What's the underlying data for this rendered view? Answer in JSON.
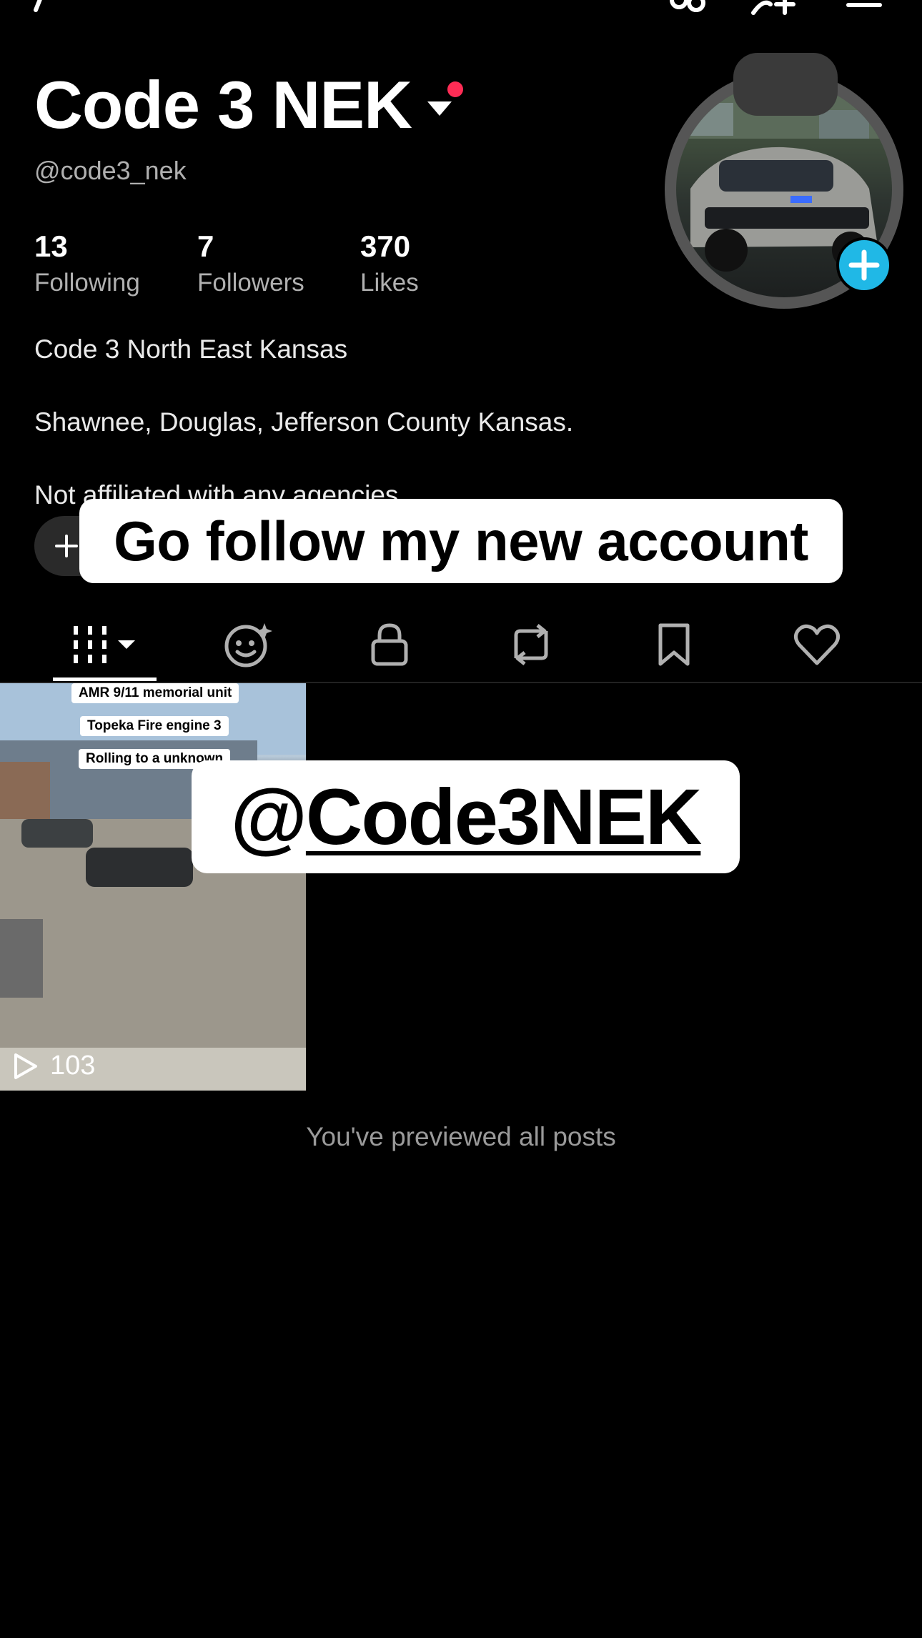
{
  "profile": {
    "display_name": "Code 3 NEK",
    "username": "@code3_nek",
    "stats": [
      {
        "value": "13",
        "label": "Following"
      },
      {
        "value": "7",
        "label": "Followers"
      },
      {
        "value": "370",
        "label": "Likes"
      }
    ],
    "bio": [
      "Code 3 North East Kansas",
      "Shawnee, Douglas, Jefferson County Kansas.",
      "Not affiliated with any agencies."
    ]
  },
  "overlay": {
    "sticker_top": "Go follow my new account",
    "sticker_handle_at": "@",
    "sticker_handle_name": "Code3NEK"
  },
  "tabs": [
    {
      "name": "videos",
      "icon": "grid-icon"
    },
    {
      "name": "ai-self",
      "icon": "face-sparkle-icon"
    },
    {
      "name": "private",
      "icon": "lock-icon"
    },
    {
      "name": "reposts",
      "icon": "repost-icon"
    },
    {
      "name": "favorites",
      "icon": "bookmark-icon"
    },
    {
      "name": "liked",
      "icon": "heart-icon"
    }
  ],
  "video": {
    "captions": [
      "AMR 9/11 memorial unit",
      "Topeka Fire engine 3",
      "Rolling to a unknown"
    ],
    "views": "103"
  },
  "footer_text": "You've previewed all posts",
  "colors": {
    "background": "#000000",
    "notification": "#fe2c55",
    "add_button": "#20b8e6"
  }
}
